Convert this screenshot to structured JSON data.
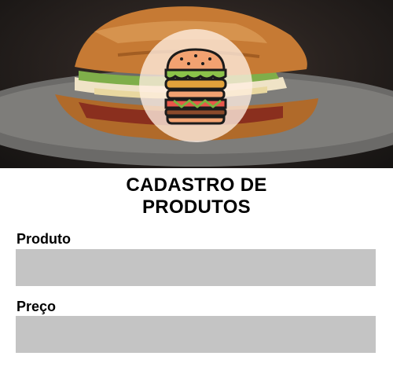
{
  "hero": {
    "image": "sandwich-photo",
    "logo_icon": "hamburger-icon"
  },
  "title": {
    "line1": "CADASTRO DE",
    "line2": "PRODUTOS"
  },
  "form": {
    "produto": {
      "label": "Produto",
      "value": "",
      "placeholder": ""
    },
    "preco": {
      "label": "Preço",
      "value": "",
      "placeholder": ""
    }
  },
  "colors": {
    "field_bg": "#c4c4c4",
    "text": "#000000",
    "background": "#ffffff"
  }
}
